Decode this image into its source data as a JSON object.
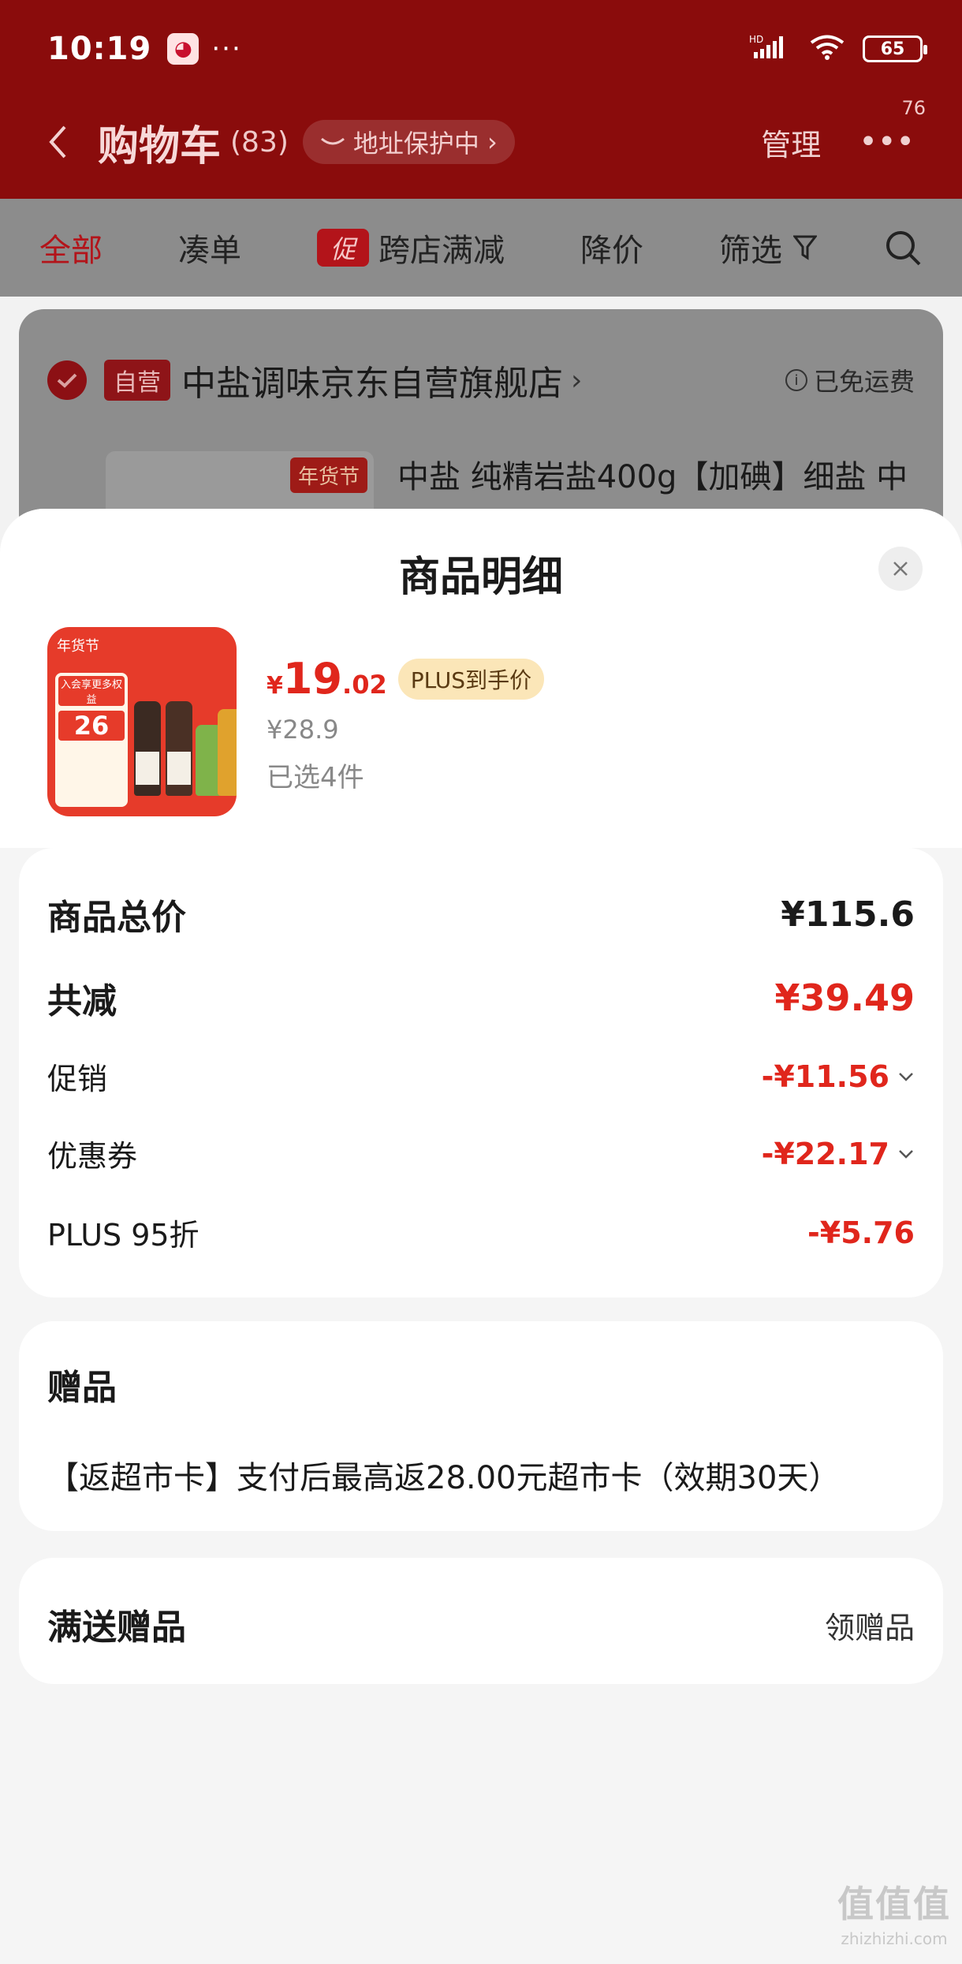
{
  "status_bar": {
    "time": "10:19",
    "dots": "···",
    "signal": "HD",
    "battery": "65"
  },
  "nav": {
    "title": "购物车",
    "count": "(83)",
    "address_pill": "地址保护中",
    "manage": "管理",
    "more_badge": "76"
  },
  "filters": {
    "all": "全部",
    "combine": "凑单",
    "promo_tag": "促",
    "cross_store": "跨店满减",
    "price_drop": "降价",
    "screen": "筛选"
  },
  "store": {
    "self_tag": "自营",
    "name": "中盐调味京东自营旗舰店",
    "free_shipping": "已免运费",
    "product_title": "中盐 纯精岩盐400g【加碘】细盐 中",
    "thumb_tag": "年货节"
  },
  "sheet": {
    "title": "商品明细",
    "product": {
      "img_top_left": "年货节",
      "img_panel_title": "入会享更多权益",
      "img_panel_value": "26",
      "price_symbol": "¥",
      "price_int": "19",
      "price_dec": ".02",
      "plus_label": "PLUS到手价",
      "original_price": "¥28.9",
      "selected": "已选4件"
    },
    "summary": {
      "total_label": "商品总价",
      "total_value": "¥115.6",
      "reduce_label": "共减",
      "reduce_value": "¥39.49",
      "promo_label": "促销",
      "promo_value": "-¥11.56",
      "coupon_label": "优惠券",
      "coupon_value": "-¥22.17",
      "plus_label": "PLUS 95折",
      "plus_value": "-¥5.76"
    },
    "gift": {
      "title": "赠品",
      "desc": "【返超市卡】支付后最高返28.00元超市卡（效期30天）"
    },
    "full_gift": {
      "title": "满送赠品",
      "action": "领赠品"
    }
  },
  "watermark": {
    "logo": "值值值",
    "url": "zhizhizhi.com"
  },
  "colors": {
    "header_red": "#8a0c0c",
    "price_red": "#e0261c",
    "plus_gold": "#fbe6b8"
  }
}
